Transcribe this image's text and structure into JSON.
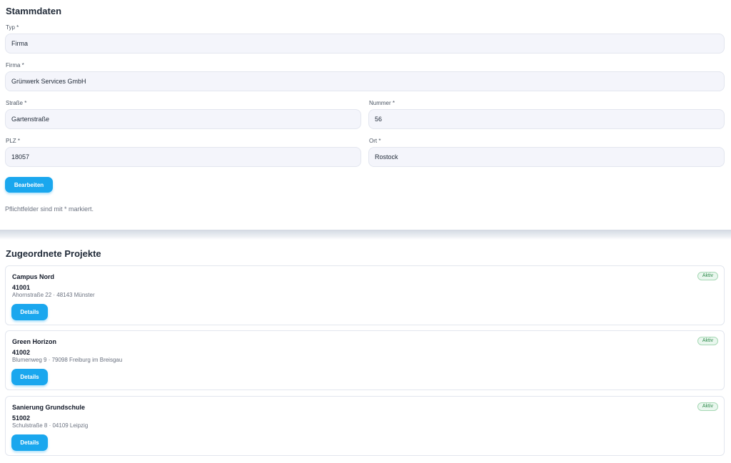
{
  "stammdaten": {
    "title": "Stammdaten",
    "typ": {
      "label": "Typ *",
      "value": "Firma"
    },
    "firma": {
      "label": "Firma *",
      "value": "Grünwerk Services GmbH"
    },
    "strasse": {
      "label": "Straße *",
      "value": "Gartenstraße"
    },
    "nummer": {
      "label": "Nummer *",
      "value": "56"
    },
    "plz": {
      "label": "PLZ *",
      "value": "18057"
    },
    "ort": {
      "label": "Ort *",
      "value": "Rostock"
    },
    "edit_label": "Bearbeiten",
    "hint": "Pflichtfelder sind mit * markiert."
  },
  "projekte": {
    "title": "Zugeordnete Projekte",
    "items": [
      {
        "name": "Campus Nord",
        "number": "41001",
        "address": "Ahornstraße 22 · 48143 Münster",
        "status": "Aktiv",
        "details_label": "Details"
      },
      {
        "name": "Green Horizon",
        "number": "41002",
        "address": "Blumenweg 9 · 79098 Freiburg im Breisgau",
        "status": "Aktiv",
        "details_label": "Details"
      },
      {
        "name": "Sanierung Grundschule",
        "number": "51002",
        "address": "Schulstraße 8 · 04109 Leipzig",
        "status": "Aktiv",
        "details_label": "Details"
      }
    ]
  },
  "colors": {
    "accent": "#1aa7ee",
    "status_active": "#2f8a4b",
    "input_bg": "#f4f5fb"
  }
}
